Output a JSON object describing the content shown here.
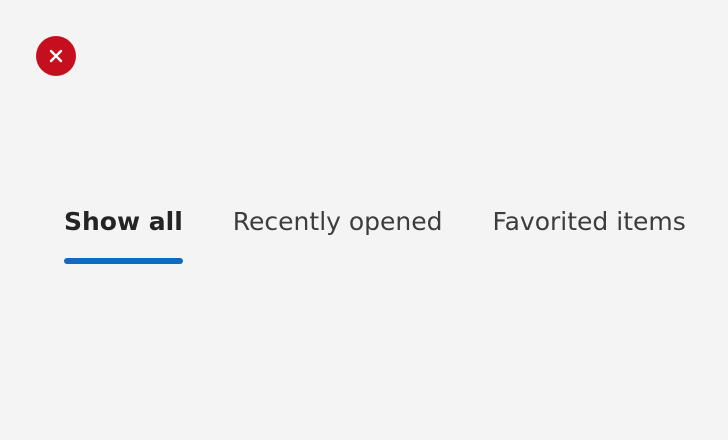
{
  "status": {
    "icon": "error-dismiss-icon",
    "color": "#c50f1f"
  },
  "tabs": [
    {
      "label": "Show all",
      "selected": true
    },
    {
      "label": "Recently opened",
      "selected": false
    },
    {
      "label": "Favorited items",
      "selected": false
    }
  ],
  "colors": {
    "accent": "#0f6cbd",
    "background": "#f4f4f4",
    "error": "#c50f1f"
  }
}
